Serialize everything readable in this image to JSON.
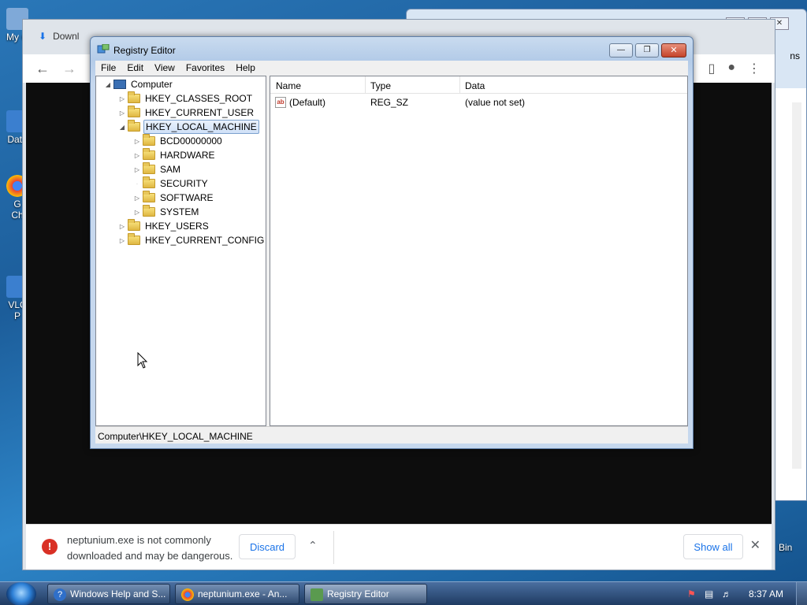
{
  "desktop": {
    "icons": [
      {
        "label": "My C"
      },
      {
        "label": "Data"
      },
      {
        "label": "G",
        "label2": "Ch"
      },
      {
        "label": "VLC",
        "label2": "P"
      }
    ],
    "right_label": "Bin"
  },
  "bg_window": {
    "edge_text": "ns"
  },
  "chrome": {
    "download_tab": "Downl",
    "download_bar": {
      "message": "neptunium.exe is not commonly downloaded and may be dangerous.",
      "discard_label": "Discard",
      "show_all_label": "Show all"
    }
  },
  "regedit": {
    "title": "Registry Editor",
    "menu": [
      "File",
      "Edit",
      "View",
      "Favorites",
      "Help"
    ],
    "tree": {
      "root": "Computer",
      "hives": [
        {
          "label": "HKEY_CLASSES_ROOT"
        },
        {
          "label": "HKEY_CURRENT_USER"
        },
        {
          "label": "HKEY_LOCAL_MACHINE",
          "selected": true,
          "children": [
            "BCD00000000",
            "HARDWARE",
            "SAM",
            "SECURITY",
            "SOFTWARE",
            "SYSTEM"
          ]
        },
        {
          "label": "HKEY_USERS"
        },
        {
          "label": "HKEY_CURRENT_CONFIG"
        }
      ]
    },
    "list": {
      "columns": [
        "Name",
        "Type",
        "Data"
      ],
      "rows": [
        {
          "name": "(Default)",
          "type": "REG_SZ",
          "data": "(value not set)"
        }
      ]
    },
    "status": "Computer\\HKEY_LOCAL_MACHINE"
  },
  "taskbar": {
    "buttons": [
      {
        "label": "Windows Help and S..."
      },
      {
        "label": "neptunium.exe - An..."
      },
      {
        "label": "Registry Editor",
        "active": true
      }
    ],
    "clock": "8:37 AM"
  },
  "colors": {
    "accent": "#1a73e8",
    "danger": "#d93025"
  }
}
